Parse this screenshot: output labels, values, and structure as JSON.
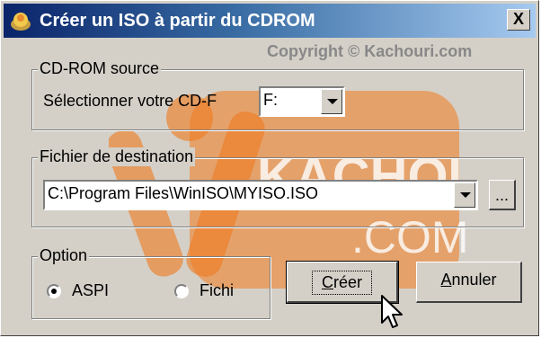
{
  "window": {
    "title": "Créer un ISO à partir du CDROM",
    "close_label": "X",
    "copyright": "Copyright © Kachouri.com"
  },
  "cdrom": {
    "legend": "CD-ROM source",
    "select_label": "Sélectionner votre CD-F",
    "drive_value": "F:"
  },
  "destination": {
    "legend": "Fichier de destination",
    "path_value": "C:\\Program Files\\WinISO\\MYISO.ISO",
    "browse_label": "..."
  },
  "option": {
    "legend": "Option",
    "radio1_label": "ASPI",
    "radio1_checked": true,
    "radio2_label": "Fichi",
    "radio2_checked": false
  },
  "buttons": {
    "create_label": "Créer",
    "create_underline": "C",
    "cancel_label": "Annuler",
    "cancel_underline": "A"
  },
  "watermark": {
    "line1": "KACHOURI",
    "line2": ".COM"
  },
  "colors": {
    "titlebar_start": "#0a246a",
    "titlebar_end": "#a6caf0",
    "dialog_face": "#d4d0c8",
    "watermark_orange": "#f07a1e"
  }
}
